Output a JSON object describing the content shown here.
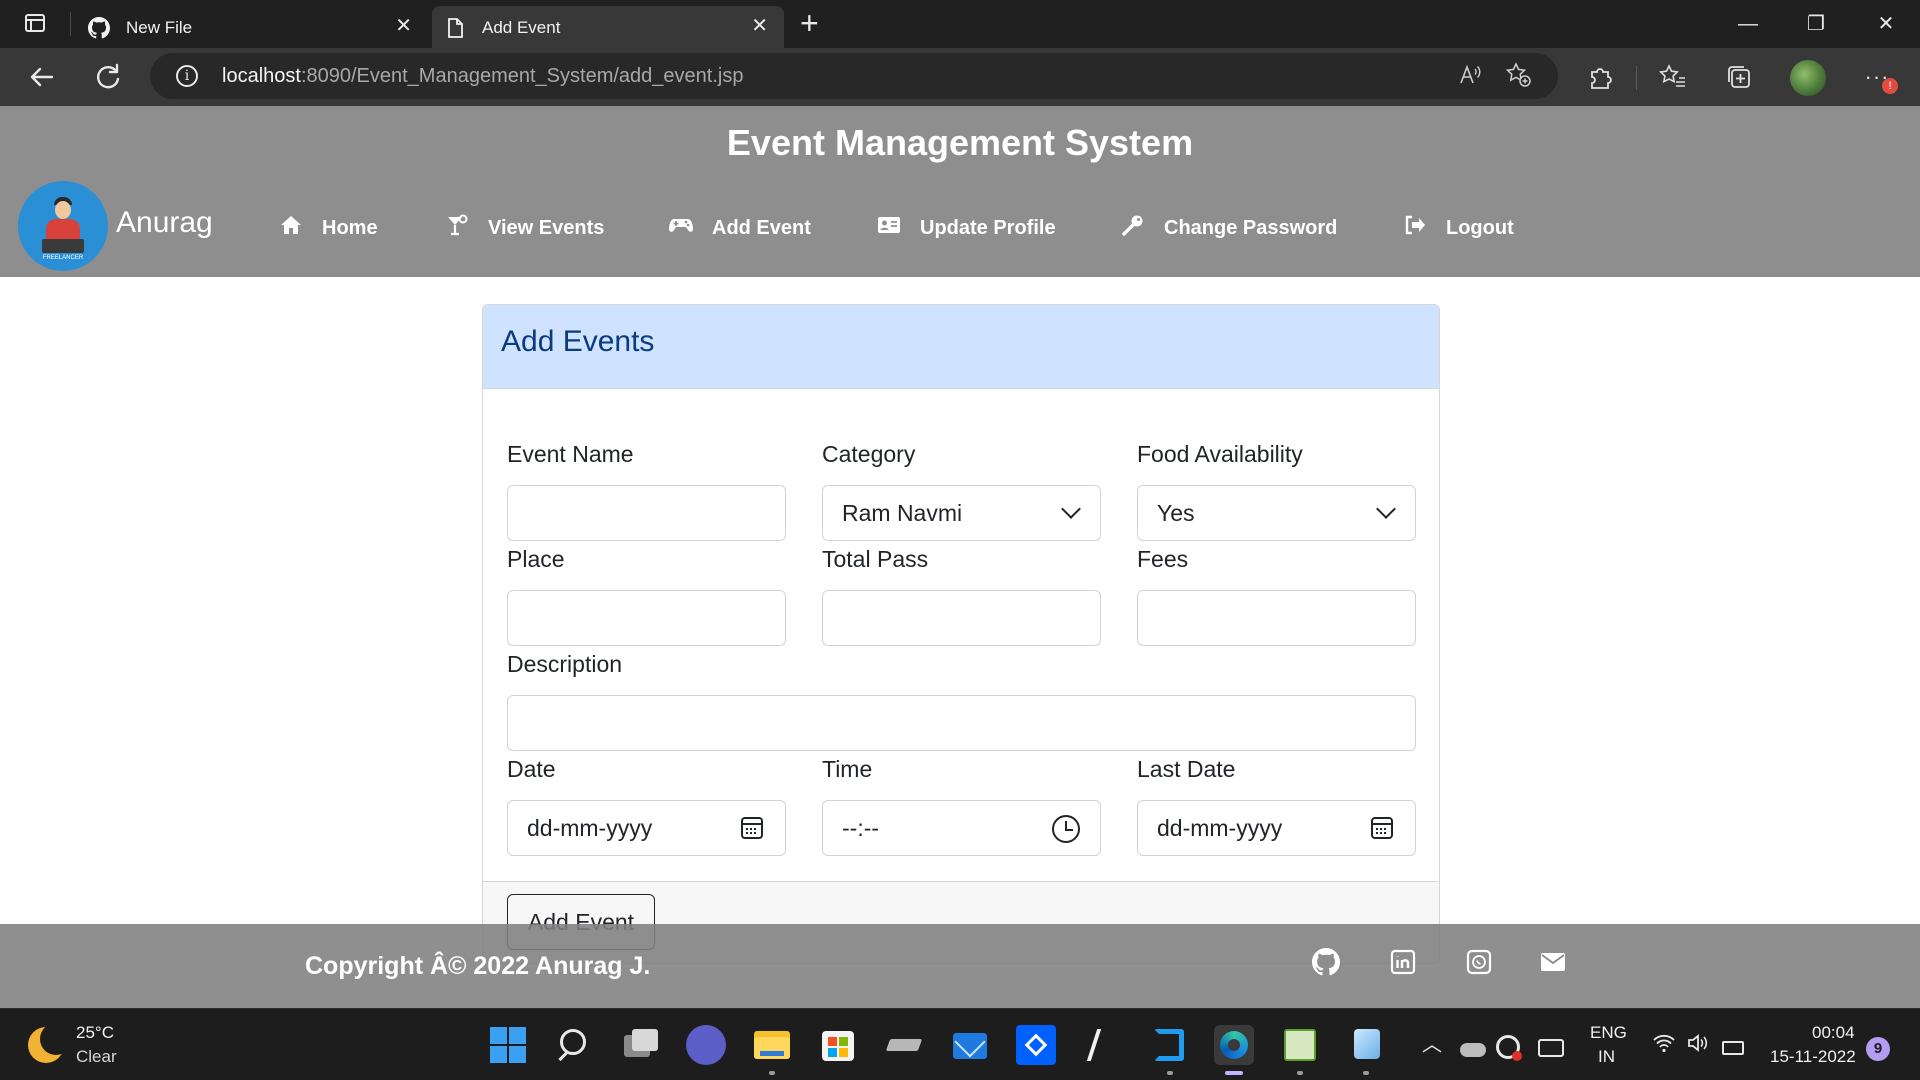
{
  "browser": {
    "tabs": [
      {
        "title": "New File",
        "favicon": "github-icon",
        "active": false
      },
      {
        "title": "Add Event",
        "favicon": "page-icon",
        "active": true
      }
    ],
    "close_glyph": "✕",
    "new_tab_glyph": "+",
    "window_buttons": {
      "minimize": "—",
      "maximize": "❐",
      "close": "✕"
    },
    "url_host": "localhost",
    "url_path": ":8090/Event_Management_System/add_event.jsp",
    "more_glyph": "···",
    "notification_badge": "!"
  },
  "header": {
    "site_title": "Event Management System",
    "brand_name": "Anurag",
    "logo_caption": "FREELANCER",
    "nav": [
      {
        "label": "Home",
        "icon": "home-icon",
        "glyph": "⌂"
      },
      {
        "label": "View Events",
        "icon": "cocktail-icon",
        "glyph": "🍸"
      },
      {
        "label": "Add Event",
        "icon": "gamepad-icon",
        "glyph": "🎮"
      },
      {
        "label": "Update Profile",
        "icon": "id-card-icon",
        "glyph": "🪪"
      },
      {
        "label": "Change Password",
        "icon": "key-icon",
        "glyph": "🔑"
      },
      {
        "label": "Logout",
        "icon": "logout-icon",
        "glyph": "⇥"
      }
    ]
  },
  "form": {
    "title": "Add Events",
    "fields": {
      "event_name": {
        "label": "Event Name",
        "value": ""
      },
      "category": {
        "label": "Category",
        "value": "Ram Navmi"
      },
      "food": {
        "label": "Food Availability",
        "value": "Yes"
      },
      "place": {
        "label": "Place",
        "value": ""
      },
      "total_pass": {
        "label": "Total Pass",
        "value": ""
      },
      "fees": {
        "label": "Fees",
        "value": ""
      },
      "description": {
        "label": "Description",
        "value": ""
      },
      "date": {
        "label": "Date",
        "value": "dd-mm-yyyy"
      },
      "time": {
        "label": "Time",
        "value": "--:--"
      },
      "last_date": {
        "label": "Last Date",
        "value": "dd-mm-yyyy"
      }
    },
    "submit_label": "Add Event"
  },
  "footer": {
    "copyright": "Copyright Â© 2022 Anurag J.",
    "social": [
      "github-icon",
      "linkedin-icon",
      "whatsapp-icon",
      "envelope-icon"
    ]
  },
  "taskbar": {
    "weather_temp": "25°C",
    "weather_desc": "Clear",
    "lang_line1": "ENG",
    "lang_line2": "IN",
    "time": "00:04",
    "date": "15-11-2022",
    "notification_count": "9"
  },
  "colors": {
    "header_bg": "#8e8e8e",
    "card_header_bg": "#cfe2ff",
    "card_title": "#0a3b7e",
    "tabbar_bg": "#202020",
    "toolbar_bg": "#383838"
  }
}
